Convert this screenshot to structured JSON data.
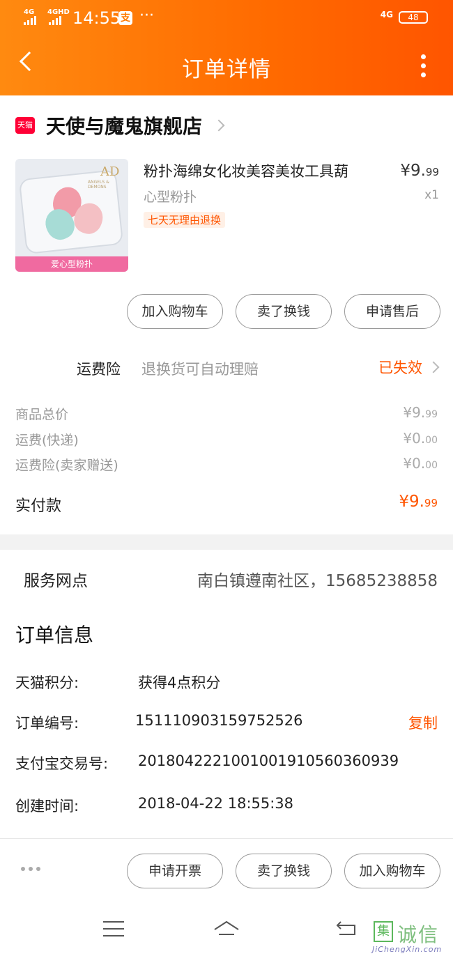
{
  "status_bar": {
    "net1": "4G",
    "net2": "4GHD",
    "time": "14:55",
    "app_badge": "支",
    "more": "···",
    "net3": "4G",
    "battery": "48"
  },
  "header": {
    "title": "订单详情",
    "back_icon": "chevron-left-icon",
    "more_icon": "more-vertical-icon"
  },
  "shop": {
    "badge": "天猫",
    "name": "天使与魔鬼旗舰店"
  },
  "product": {
    "thumb_logo": "AD",
    "thumb_logo_sub": "ANGELS & DEMONS",
    "thumb_ribbon": "爱心型粉扑",
    "name": "粉扑海绵女化妆美容美妆工具葫",
    "sku": "心型粉扑",
    "tag": "七天无理由退换",
    "price_int": "¥9.",
    "price_dec": "99",
    "qty": "x1"
  },
  "item_actions": {
    "add_cart": "加入购物车",
    "sell": "卖了换钱",
    "after_sale": "申请售后"
  },
  "insurance": {
    "label": "运费险",
    "desc": "退换货可自动理赔",
    "status": "已失效"
  },
  "costs": {
    "rows": [
      {
        "label": "商品总价",
        "int": "¥9.",
        "dec": "99"
      },
      {
        "label": "运费(快递)",
        "int": "¥0.",
        "dec": "00"
      },
      {
        "label": "运费险(卖家赠送)",
        "int": "¥0.",
        "dec": "00"
      }
    ],
    "paid_label": "实付款",
    "paid_int": "¥9.",
    "paid_dec": "99"
  },
  "service": {
    "label": "服务网点",
    "value": "南白镇遵南社区，15685238858"
  },
  "order_info": {
    "title": "订单信息",
    "points_label": "天猫积分:",
    "points_value": "获得4点积分",
    "order_no_label": "订单编号:",
    "order_no_value": "1511109031597525​26",
    "copy": "复制",
    "alipay_label": "支付宝交易号:",
    "alipay_value": "2018042221001001910560360939",
    "created_label": "创建时间:",
    "created_value": "2018-04-22 18:55:38"
  },
  "bottom_actions": {
    "invoice": "申请开票",
    "sell": "卖了换钱",
    "add_cart": "加入购物车"
  },
  "watermark": {
    "mark": "集",
    "text": "诚信",
    "sub": "JiChengXin.com"
  },
  "colors": {
    "header_start": "#ff8a10",
    "header_end": "#ff5500",
    "accent": "#ff5500",
    "tmall_red": "#ff0036"
  }
}
